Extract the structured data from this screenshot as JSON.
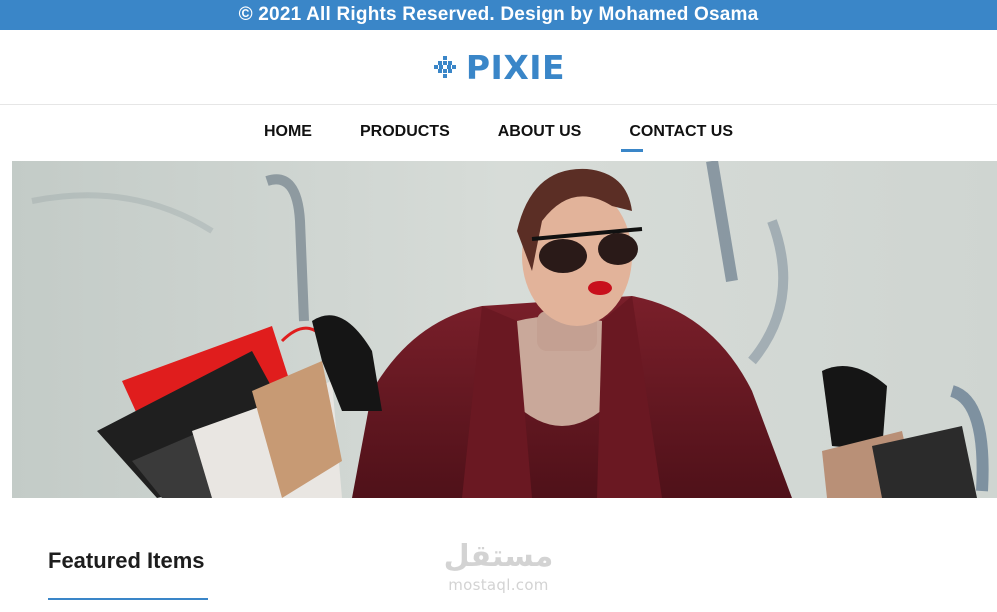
{
  "topbar": {
    "text": "© 2021 All Rights Reserved. Design by Mohamed Osama"
  },
  "brand": {
    "name": "PIXIE",
    "color": "#3a86c8"
  },
  "nav": {
    "items": [
      {
        "label": "HOME"
      },
      {
        "label": "PRODUCTS"
      },
      {
        "label": "ABOUT US"
      },
      {
        "label": "CONTACT US",
        "active": true
      }
    ]
  },
  "hero": {
    "icon": "hero-image"
  },
  "featured": {
    "title": "Featured Items"
  },
  "watermark": {
    "arabic": "مستقل",
    "latin": "mostaql.com"
  }
}
